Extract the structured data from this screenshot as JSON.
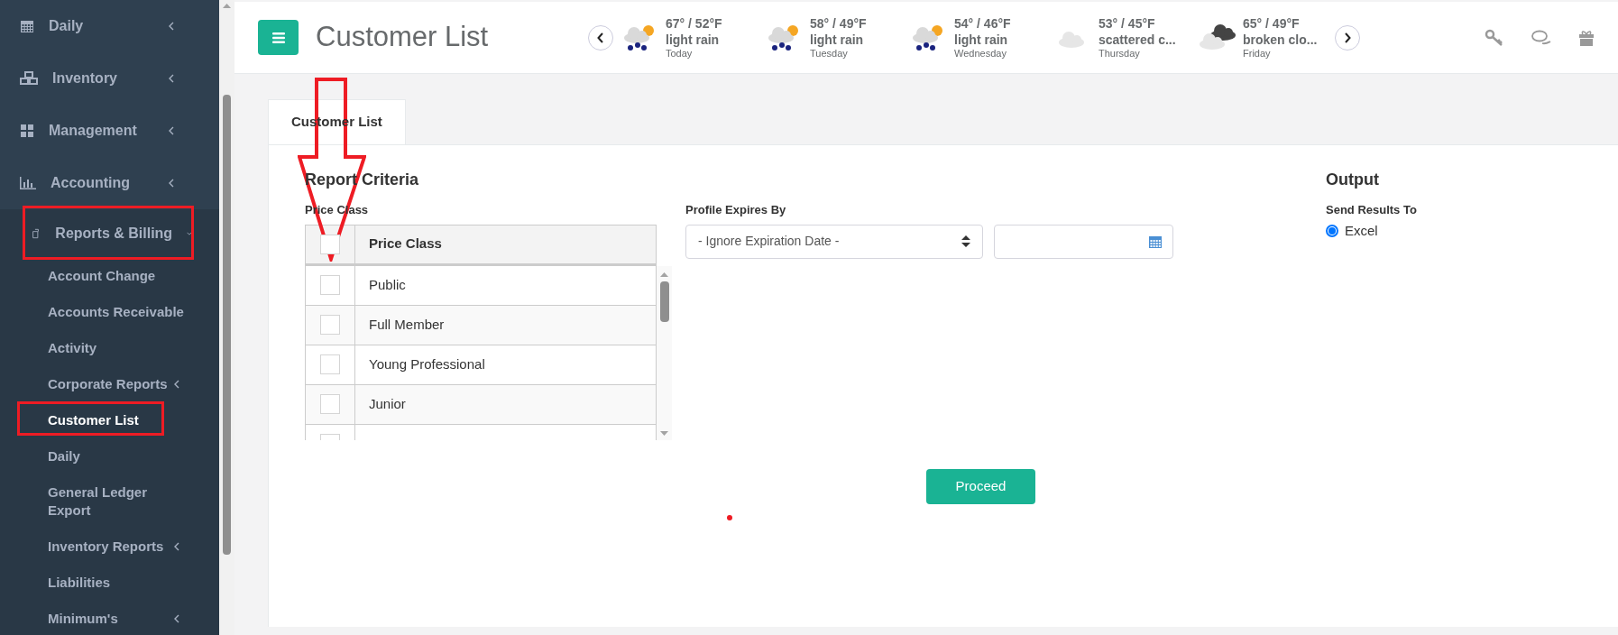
{
  "sidebar": {
    "items": [
      {
        "label": "Daily",
        "kind": "calendar",
        "expanded": false,
        "highlighted": false
      },
      {
        "label": "Inventory",
        "kind": "cubes",
        "expanded": false,
        "highlighted": false
      },
      {
        "label": "Management",
        "kind": "grid",
        "expanded": false,
        "highlighted": false
      },
      {
        "label": "Accounting",
        "kind": "chart",
        "expanded": false,
        "highlighted": false
      },
      {
        "label": "Reports & Billing",
        "kind": "report",
        "expanded": true,
        "highlighted": true,
        "children": [
          {
            "label": "Account Change",
            "kind": "link",
            "selected": false,
            "highlighted": false
          },
          {
            "label": "Accounts Receivable",
            "kind": "link",
            "selected": false,
            "highlighted": false
          },
          {
            "label": "Activity",
            "kind": "link",
            "selected": false,
            "highlighted": false
          },
          {
            "label": "Corporate Reports",
            "kind": "submenu",
            "selected": false,
            "highlighted": false
          },
          {
            "label": "Customer List",
            "kind": "link",
            "selected": true,
            "highlighted": true
          },
          {
            "label": "Daily",
            "kind": "link",
            "selected": false,
            "highlighted": false
          },
          {
            "label": "General Ledger Export",
            "kind": "link",
            "selected": false,
            "highlighted": false
          },
          {
            "label": "Inventory Reports",
            "kind": "submenu",
            "selected": false,
            "highlighted": false
          },
          {
            "label": "Liabilities",
            "kind": "link",
            "selected": false,
            "highlighted": false
          },
          {
            "label": "Minimum's",
            "kind": "submenu",
            "selected": false,
            "highlighted": false
          }
        ]
      }
    ]
  },
  "header": {
    "title": "Customer List",
    "forecast": [
      {
        "temps": "67° / 52°F",
        "summary": "light rain",
        "day": "Today",
        "kind": "rain"
      },
      {
        "temps": "58° / 49°F",
        "summary": "light rain",
        "day": "Tuesday",
        "kind": "rain"
      },
      {
        "temps": "54° / 46°F",
        "summary": "light rain",
        "day": "Wednesday",
        "kind": "rain"
      },
      {
        "temps": "53° / 45°F",
        "summary": "scattered c...",
        "day": "Thursday",
        "kind": "cloud"
      },
      {
        "temps": "65° / 49°F",
        "summary": "broken clo...",
        "day": "Friday",
        "kind": "broken"
      }
    ]
  },
  "tabs": [
    {
      "label": "Customer List",
      "selected": true
    }
  ],
  "criteria": {
    "title": "Report Criteria",
    "price_class_label": "Price Class",
    "table": {
      "header": "Price Class",
      "header_checked": false,
      "rows": [
        {
          "label": "Public",
          "checked": false
        },
        {
          "label": "Full Member",
          "checked": false
        },
        {
          "label": "Young Professional",
          "checked": false
        },
        {
          "label": "Junior",
          "checked": false
        },
        {
          "checked": false
        }
      ]
    },
    "expires_label": "Profile Expires By",
    "expires_value": "- Ignore Expiration Date -"
  },
  "output": {
    "title": "Output",
    "send_label": "Send Results To",
    "options": [
      {
        "label": "Excel",
        "selected": true
      }
    ]
  },
  "proceed": "Proceed",
  "annotations": {
    "arrow": true,
    "dot": true
  }
}
